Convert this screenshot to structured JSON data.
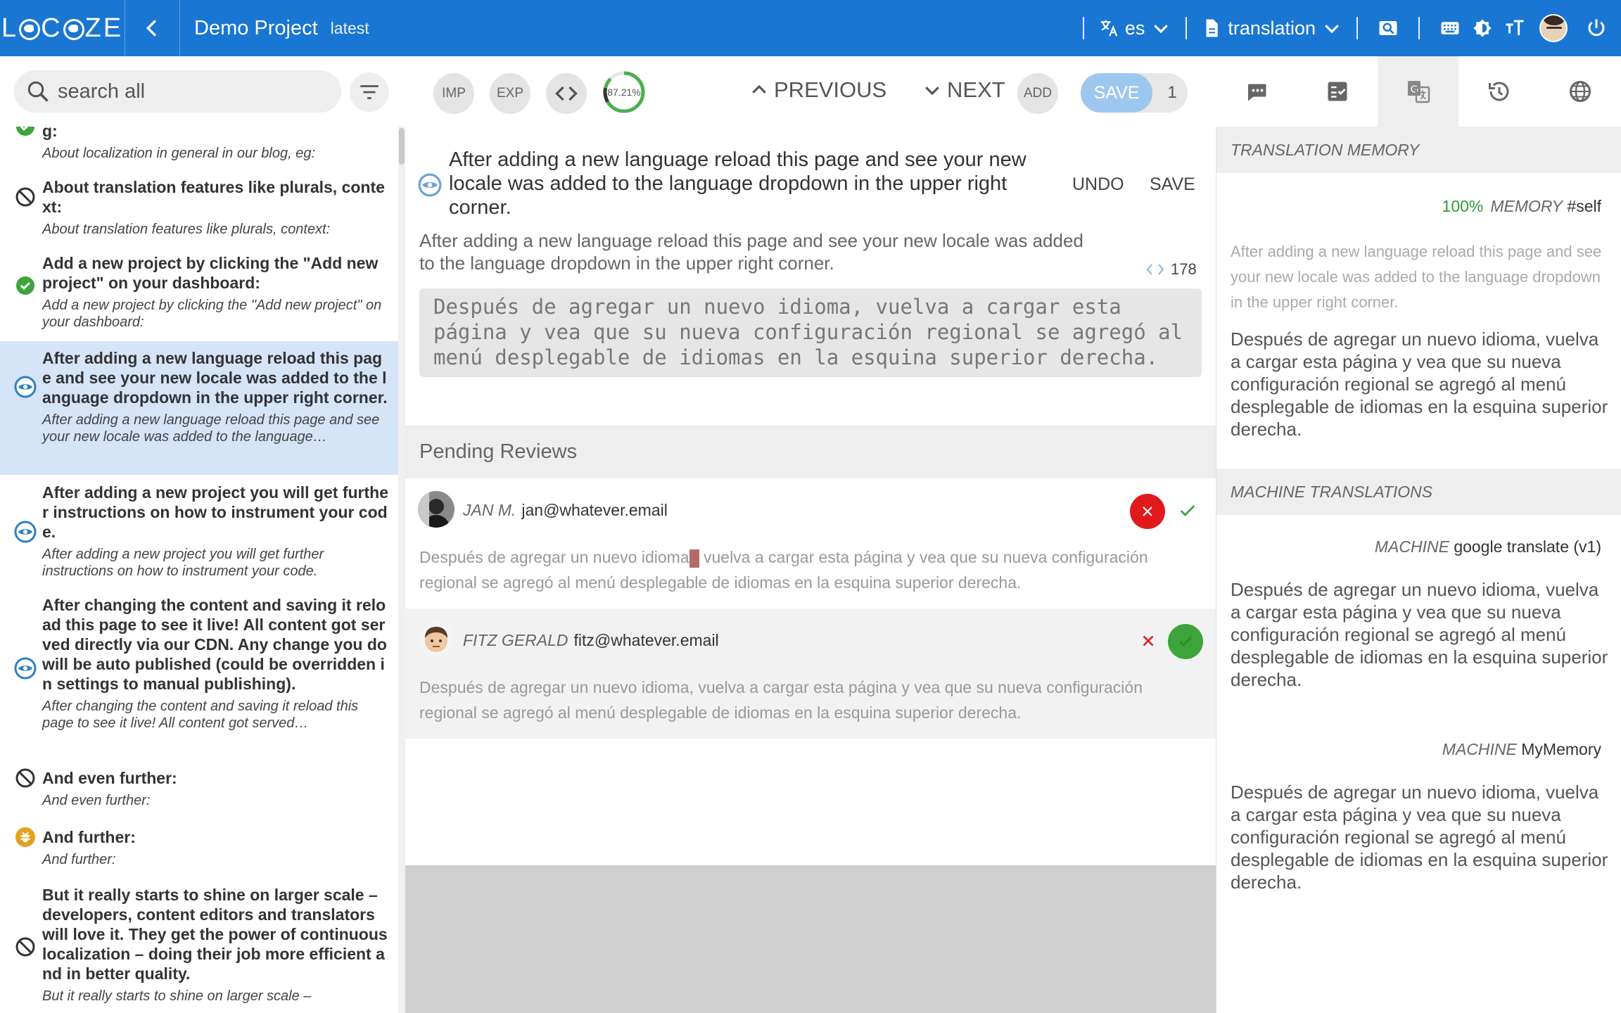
{
  "header": {
    "logo": "L❍C❍ZE",
    "logo_parts": [
      "L",
      "C",
      "ZE"
    ],
    "project_name": "Demo Project",
    "version": "latest",
    "language": "es",
    "namespace": "translation"
  },
  "toolbar": {
    "search_placeholder": "search all",
    "imp_label": "IMP",
    "exp_label": "EXP",
    "progress_label": "87.21%",
    "progress_value": 0.8721,
    "previous_label": "PREVIOUS",
    "next_label": "NEXT",
    "add_label": "ADD",
    "save_label": "SAVE",
    "save_count": "1"
  },
  "keys": [
    {
      "title": "g:",
      "sub": "About localization in general in our blog, eg:",
      "status": "done"
    },
    {
      "title": "About translation features like plurals, context:",
      "sub": "About translation features like plurals, context:",
      "status": "blocked"
    },
    {
      "title": "Add a new project by clicking the \"Add new project\" on your dashboard:",
      "sub": "Add a new project by clicking the \"Add new project\" on your dashboard:",
      "status": "done"
    },
    {
      "title": "After adding a new language reload this page and see your new locale was added to the language dropdown in the upper right corner.",
      "sub": "After adding a new language reload this page and see your new locale was added to the language…",
      "status": "review"
    },
    {
      "title": "After adding a new project you will get further instructions on how to instrument your code.",
      "sub": "After adding a new project you will get further instructions on how to instrument your code.",
      "status": "review"
    },
    {
      "title": "After changing the content and saving it reload this page to see it live! All content got served directly via our CDN. Any change you do will be auto published (could be overridden in settings to manual publishing).",
      "sub": "After changing the content and saving it reload this page to see it live! All content got served…",
      "status": "review"
    },
    {
      "title": "And even further:",
      "sub": "And even further:",
      "status": "blocked"
    },
    {
      "title": "And further:",
      "sub": "And further:",
      "status": "warning"
    },
    {
      "title": "But it really starts to shine on larger scale – developers, content editors and translators will love it. They get the power of continuous localization – doing their job more efficient and in better quality.",
      "sub": "But it really starts to shine on larger scale –",
      "status": "blocked"
    }
  ],
  "editor": {
    "key": "After adding a new language reload this page and see your new locale was added to the language dropdown in the upper right corner.",
    "undo_label": "UNDO",
    "save_label": "SAVE",
    "source": "After adding a new language reload this page and see your new locale was added to the language dropdown in the upper right corner.",
    "char_count": "178",
    "translation": "Después de agregar un nuevo idioma, vuelva a cargar esta página y vea que su nueva configuración regional se agregó al menú desplegable de idiomas en la esquina superior derecha."
  },
  "pending": {
    "title": "Pending Reviews",
    "reviews": [
      {
        "name": "JAN M.",
        "email": "jan@whatever.email",
        "text_before": "Después de agregar un nuevo idioma",
        "text_after": " vuelva a cargar esta página y vea que su nueva configuración regional se agregó al menú desplegable de idiomas en la esquina superior derecha."
      },
      {
        "name": "FITZ GERALD",
        "email": "fitz@whatever.email",
        "text": "Después de agregar un nuevo idioma, vuelva a cargar esta página y vea que su nueva configuración regional se agregó al menú desplegable de idiomas en la esquina superior derecha."
      }
    ]
  },
  "right_panel": {
    "tm_title": "TRANSLATION MEMORY",
    "tm_percent": "100%",
    "tm_label": "MEMORY",
    "tm_source_name": "#self",
    "tm_source": "After adding a new language reload this page and see your new locale was added to the language dropdown in the upper right corner.",
    "tm_translation": "Después de agregar un nuevo idioma, vuelva a cargar esta página y vea que su nueva configuración regional se agregó al menú desplegable de idiomas en la esquina superior derecha.",
    "mt_title": "MACHINE TRANSLATIONS",
    "machines": [
      {
        "label": "MACHINE",
        "provider": "google translate (v1)",
        "text": "Después de agregar un nuevo idioma, vuelva a cargar esta página y vea que su nueva configuración regional se agregó al menú desplegable de idiomas en la esquina superior derecha."
      },
      {
        "label": "MACHINE",
        "provider": "MyMemory",
        "text": "Después de agregar un nuevo idioma, vuelva a cargar esta página y vea que su nueva configuración regional se agregó al menú desplegable de idiomas en la esquina superior derecha."
      }
    ]
  },
  "colors": {
    "brand": "#1976d2",
    "done": "#3da43a",
    "review": "#2f7fc1",
    "blocked": "#333333",
    "warning": "#e3a11e",
    "reject": "#e0191c",
    "selected_row": "#d6e4f8"
  },
  "icons": {
    "status_done": "check-circle-icon",
    "status_blocked": "block-icon",
    "status_review": "eye-icon",
    "status_warning": "bug-icon"
  }
}
